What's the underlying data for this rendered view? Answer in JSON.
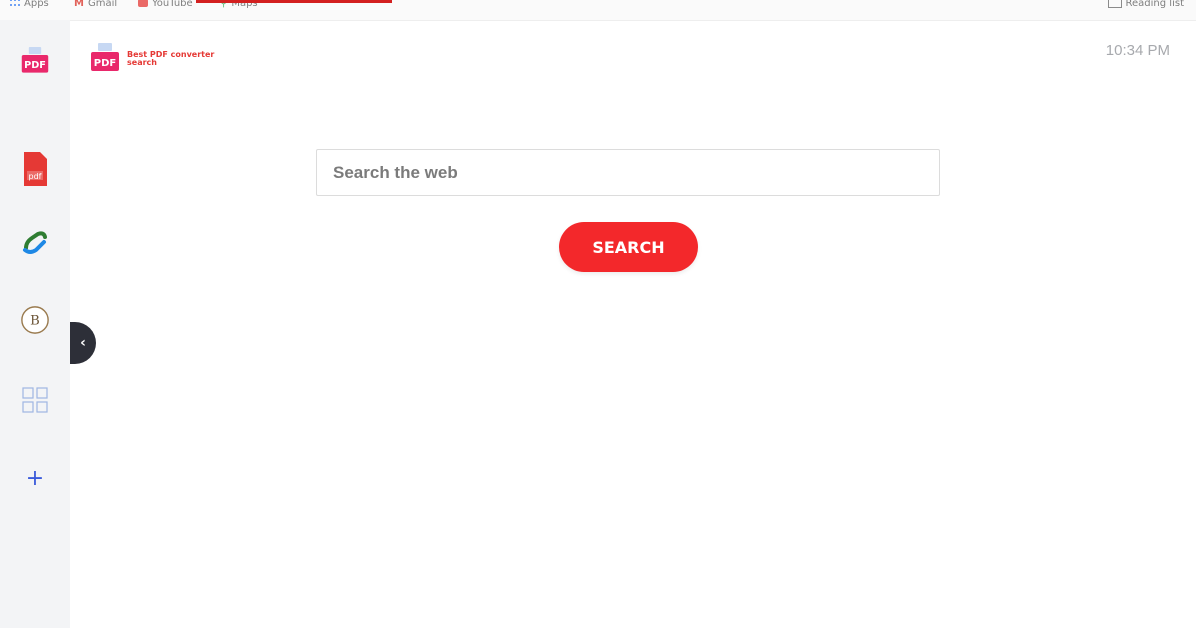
{
  "bookmarks": {
    "apps": "Apps",
    "gmail": "Gmail",
    "youtube": "YouTube",
    "maps": "Maps",
    "reading_list": "Reading list"
  },
  "brand": {
    "icon_text": "PDF",
    "name_line1": "Best PDF converter",
    "name_line2": "search"
  },
  "clock": "10:34 PM",
  "search": {
    "placeholder": "Search the web",
    "button_label": "SEARCH"
  },
  "sidebar": {
    "items": [
      {
        "icon": "pdf-logo-icon",
        "text": "PDF"
      },
      {
        "icon": "pdf-file-icon",
        "text": "pdf"
      },
      {
        "icon": "link-icon"
      },
      {
        "icon": "bitcoin-icon",
        "text": "B"
      },
      {
        "icon": "apps-grid-icon"
      },
      {
        "icon": "plus-icon",
        "text": "+"
      }
    ],
    "collapse_label": "‹"
  },
  "colors": {
    "accent": "#f3282b",
    "rail": "#f3f4f6",
    "collapse_tab": "#2d2f38"
  }
}
